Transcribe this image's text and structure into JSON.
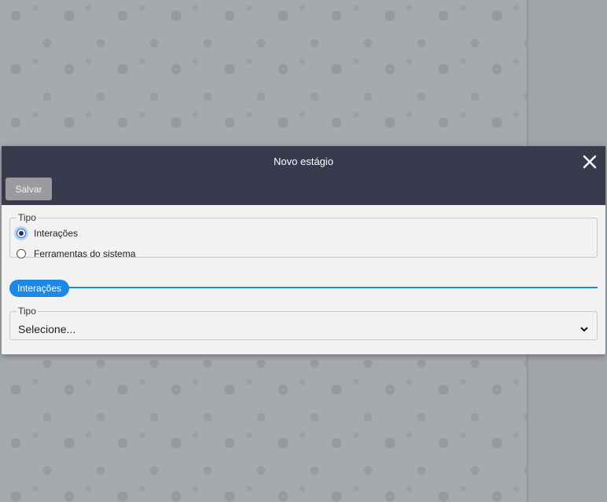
{
  "modal": {
    "title": "Novo estágio",
    "save_label": "Salvar",
    "close_icon": "close-icon"
  },
  "tipo_group": {
    "legend": "Tipo",
    "options": [
      {
        "label": "Interações",
        "checked": true
      },
      {
        "label": "Ferramentas do sistema",
        "checked": false
      }
    ]
  },
  "section": {
    "label": "Interações",
    "accent": "#1e88e5"
  },
  "tipo_select": {
    "legend": "Tipo",
    "value": "Selecione..."
  },
  "colors": {
    "header": "#3a3a4f",
    "save_button": "#9a9a9f",
    "background": "#a6a9ae"
  }
}
